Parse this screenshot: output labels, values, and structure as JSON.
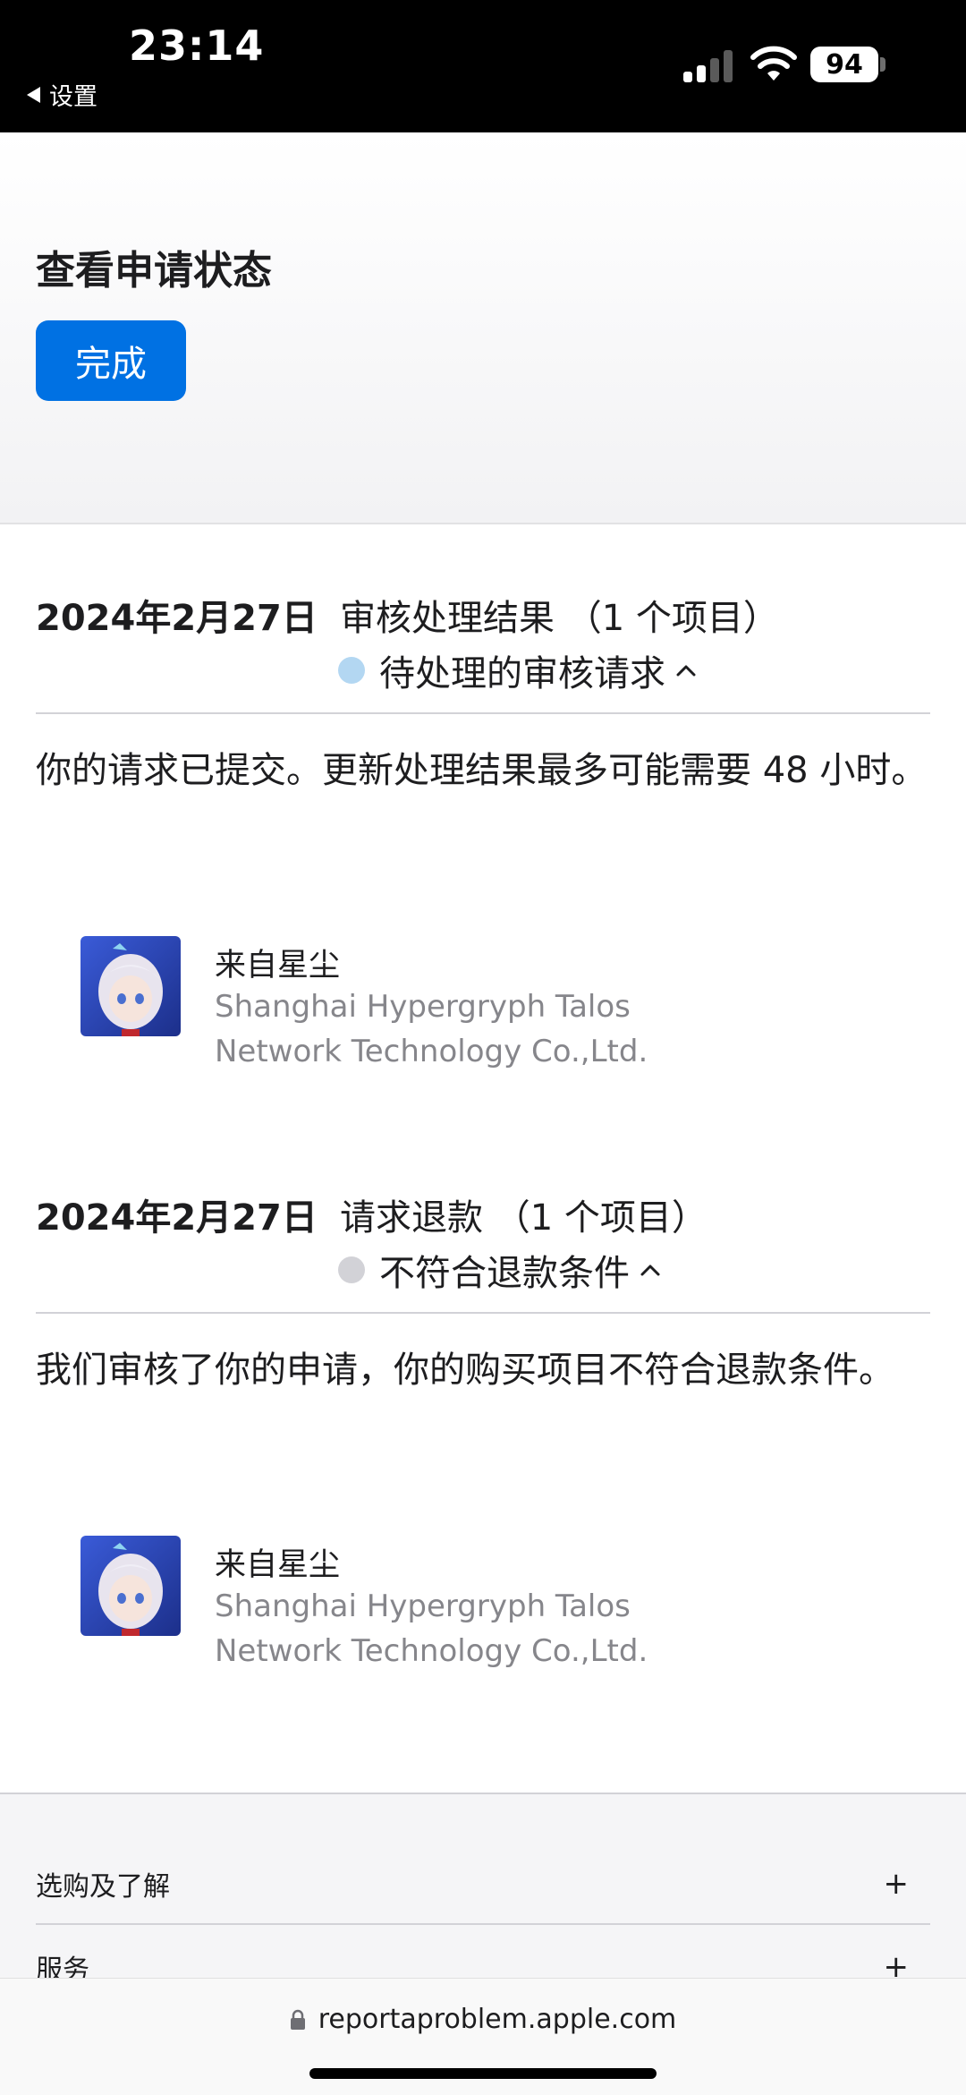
{
  "status_bar": {
    "time": "23:14",
    "back_label": "设置",
    "battery": "94"
  },
  "header": {
    "title": "查看申请状态",
    "done_label": "完成"
  },
  "requests": [
    {
      "date": "2024年2月27日",
      "type": "审核处理结果 （1 个项目）",
      "status": "待处理的审核请求",
      "status_color": "#b3d7f2",
      "message": "你的请求已提交。更新处理结果最多可能需要 48 小时。",
      "app_name": "来自星尘",
      "developer": "Shanghai Hypergryph Talos Network Technology Co.,Ltd."
    },
    {
      "date": "2024年2月27日",
      "type": "请求退款 （1 个项目）",
      "status": "不符合退款条件",
      "status_color": "#d2d2d7",
      "message": "我们审核了你的申请，你的购买项目不符合退款条件。",
      "app_name": "来自星尘",
      "developer": "Shanghai Hypergryph Talos Network Technology Co.,Ltd."
    }
  ],
  "footer": {
    "items": [
      {
        "label": "选购及了解",
        "icon": "+"
      },
      {
        "label": "服务",
        "icon": "+"
      }
    ]
  },
  "address_bar": {
    "url": "reportaproblem.apple.com"
  },
  "colors": {
    "accent": "#0071e3",
    "secondary_text": "#86868b"
  }
}
